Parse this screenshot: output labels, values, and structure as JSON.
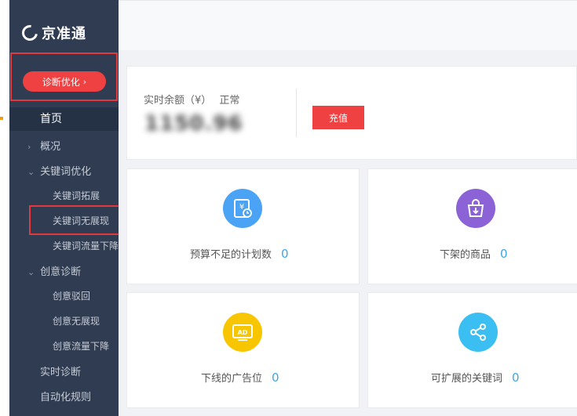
{
  "brand": {
    "name": "京准通"
  },
  "sidebar": {
    "diagnose_button": "诊断优化",
    "items": [
      {
        "label": "首页"
      },
      {
        "label": "概况"
      },
      {
        "label": "关键词优化"
      },
      {
        "label": "关键词拓展"
      },
      {
        "label": "关键词无展现"
      },
      {
        "label": "关键词流量下降"
      },
      {
        "label": "创意诊断"
      },
      {
        "label": "创意驳回"
      },
      {
        "label": "创意无展现"
      },
      {
        "label": "创意流量下降"
      },
      {
        "label": "实时诊断"
      },
      {
        "label": "自动化规则"
      }
    ]
  },
  "balance": {
    "label": "实时余额（¥）",
    "status": "正常",
    "amount": "1150.96",
    "recharge_label": "充值"
  },
  "stats": [
    {
      "label": "预算不足的计划数",
      "count": "0",
      "icon": "budget-icon",
      "color": "#4aa3f5"
    },
    {
      "label": "下架的商品",
      "count": "0",
      "icon": "shopping-bag-icon",
      "color": "#8b63d6"
    },
    {
      "label": "下线的广告位",
      "count": "0",
      "icon": "ad-icon",
      "color": "#f7c600"
    },
    {
      "label": "可扩展的关键词",
      "count": "0",
      "icon": "share-icon",
      "color": "#3bbff2"
    }
  ]
}
